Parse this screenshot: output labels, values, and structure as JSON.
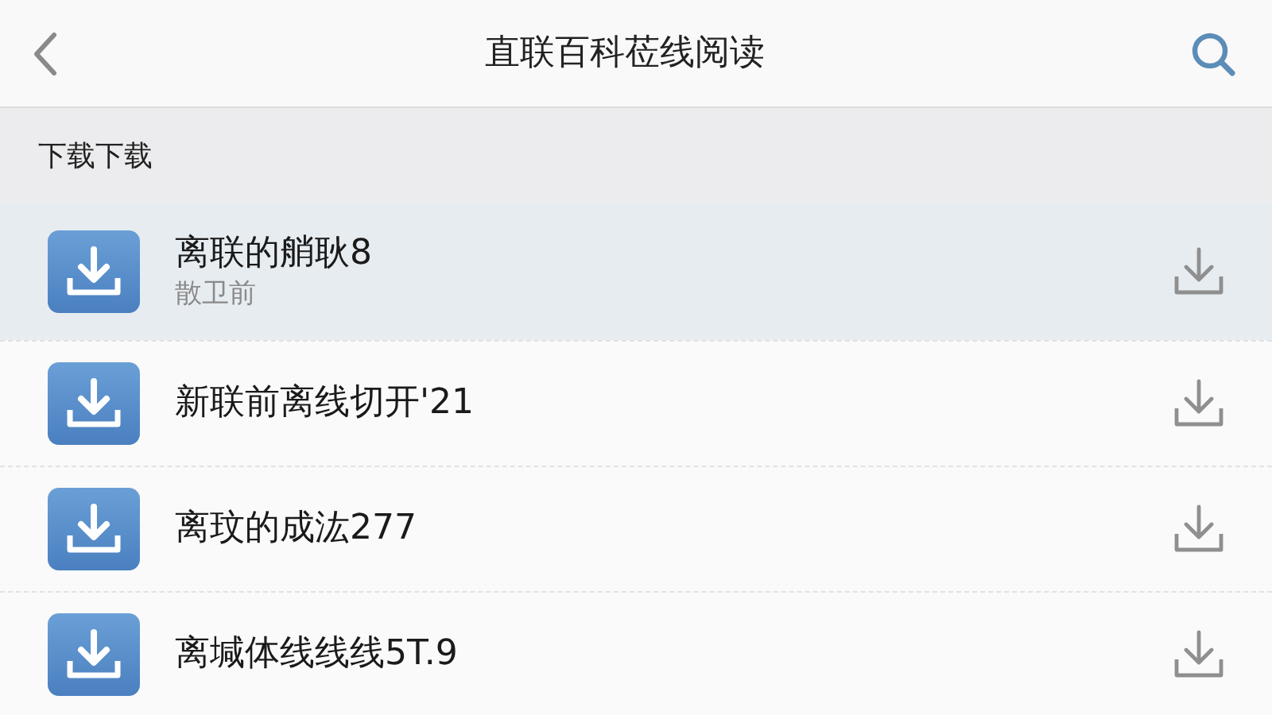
{
  "header": {
    "title": "直联百科莅线阅读"
  },
  "section": {
    "label": "下载下载"
  },
  "items": [
    {
      "title": "离联的艄耿8",
      "subtitle": "散卫前",
      "selected": true
    },
    {
      "title": "新联前离线切开'21",
      "selected": false
    },
    {
      "title": "离玟的成汯277",
      "selected": false
    },
    {
      "title": "离堿体线线线5T.9",
      "selected": false
    }
  ]
}
